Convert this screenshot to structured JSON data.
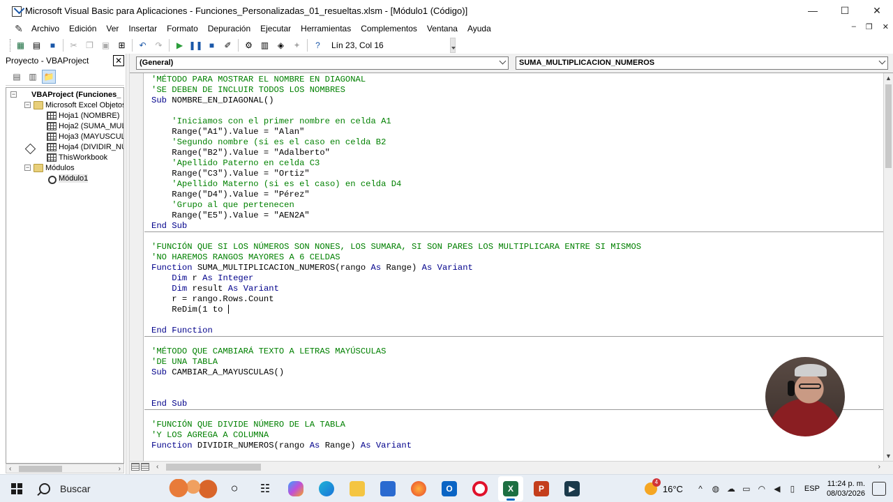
{
  "window": {
    "title": "Microsoft Visual Basic para Aplicaciones - Funciones_Personalizadas_01_resueltas.xlsm - [Módulo1 (Código)]",
    "minimize": "—",
    "maximize": "☐",
    "close": "✕"
  },
  "menu": {
    "items": [
      "Archivo",
      "Edición",
      "Ver",
      "Insertar",
      "Formato",
      "Depuración",
      "Ejecutar",
      "Herramientas",
      "Complementos",
      "Ventana",
      "Ayuda"
    ],
    "mdi_minimize": "–",
    "mdi_restore": "❐",
    "mdi_close": "✕"
  },
  "toolbar": {
    "cursor_position": "Lín 23, Col 16"
  },
  "project": {
    "title": "Proyecto - VBAProject",
    "close": "✕",
    "tree": {
      "root": "VBAProject (Funciones_",
      "excel_objects": "Microsoft Excel Objetos",
      "sheets": [
        "Hoja1 (NOMBRE)",
        "Hoja2 (SUMA_MULT",
        "Hoja3 (MAYUSCULA",
        "Hoja4 (DIVIDIR_NU"
      ],
      "workbook": "ThisWorkbook",
      "modules": "Módulos",
      "module1": "Módulo1"
    }
  },
  "code_window": {
    "object_combo": "(General)",
    "procedure_combo": "SUMA_MULTIPLICACION_NUMEROS",
    "lines": [
      [
        [
          "c",
          "'MÉTODO PARA MOSTRAR EL NOMBRE EN DIAGONAL"
        ]
      ],
      [
        [
          "c",
          "'SE DEBEN DE INCLUIR TODOS LOS NOMBRES"
        ]
      ],
      [
        [
          "k",
          "Sub"
        ],
        [
          "t",
          " NOMBRE_EN_DIAGONAL()"
        ]
      ],
      [],
      [
        [
          "c",
          "    'Iniciamos con el primer nombre en celda A1"
        ]
      ],
      [
        [
          "t",
          "    Range(\"A1\").Value = \"Alan\""
        ]
      ],
      [
        [
          "c",
          "    'Segundo nombre (si es el caso en celda B2"
        ]
      ],
      [
        [
          "t",
          "    Range(\"B2\").Value = \"Adalberto\""
        ]
      ],
      [
        [
          "c",
          "    'Apellido Paterno en celda C3"
        ]
      ],
      [
        [
          "t",
          "    Range(\"C3\").Value = \"Ortiz\""
        ]
      ],
      [
        [
          "c",
          "    'Apellido Materno (si es el caso) en celda D4"
        ]
      ],
      [
        [
          "t",
          "    Range(\"D4\").Value = \"Pérez\""
        ]
      ],
      [
        [
          "c",
          "    'Grupo al que pertenecen"
        ]
      ],
      [
        [
          "t",
          "    Range(\"E5\").Value = \"AEN2A\""
        ]
      ],
      [
        [
          "k",
          "End Sub"
        ]
      ],
      [],
      [
        [
          "c",
          "'FUNCIÓN QUE SI LOS NÚMEROS SON NONES, LOS SUMARA, SI SON PARES LOS MULTIPLICARA ENTRE SI MISMOS"
        ]
      ],
      [
        [
          "c",
          "'NO HAREMOS RANGOS MAYORES A 6 CELDAS"
        ]
      ],
      [
        [
          "k",
          "Function"
        ],
        [
          "t",
          " SUMA_MULTIPLICACION_NUMEROS(rango "
        ],
        [
          "k",
          "As"
        ],
        [
          "t",
          " Range) "
        ],
        [
          "k",
          "As"
        ],
        [
          "t",
          " "
        ],
        [
          "k",
          "Variant"
        ]
      ],
      [
        [
          "t",
          "    "
        ],
        [
          "k",
          "Dim"
        ],
        [
          "t",
          " r "
        ],
        [
          "k",
          "As"
        ],
        [
          "t",
          " "
        ],
        [
          "k",
          "Integer"
        ]
      ],
      [
        [
          "t",
          "    "
        ],
        [
          "k",
          "Dim"
        ],
        [
          "t",
          " result "
        ],
        [
          "k",
          "As"
        ],
        [
          "t",
          " "
        ],
        [
          "k",
          "Variant"
        ]
      ],
      [
        [
          "t",
          "    r = rango.Rows.Count"
        ]
      ],
      [
        [
          "t",
          "    ReDim(1 to "
        ],
        [
          "caret",
          ""
        ]
      ],
      [],
      [
        [
          "k",
          "End Function"
        ]
      ],
      [],
      [
        [
          "c",
          "'MÉTODO QUE CAMBIARÁ TEXTO A LETRAS MAYÚSCULAS"
        ]
      ],
      [
        [
          "c",
          "'DE UNA TABLA"
        ]
      ],
      [
        [
          "k",
          "Sub"
        ],
        [
          "t",
          " CAMBIAR_A_MAYUSCULAS()"
        ]
      ],
      [],
      [],
      [
        [
          "k",
          "End Sub"
        ]
      ],
      [],
      [
        [
          "c",
          "'FUNCIÓN QUE DIVIDE NÚMERO DE LA TABLA"
        ]
      ],
      [
        [
          "c",
          "'Y LOS AGREGA A COLUMNA"
        ]
      ],
      [
        [
          "k",
          "Function"
        ],
        [
          "t",
          " DIVIDIR_NUMEROS(rango "
        ],
        [
          "k",
          "As"
        ],
        [
          "t",
          " Range) "
        ],
        [
          "k",
          "As"
        ],
        [
          "t",
          " "
        ],
        [
          "k",
          "Variant"
        ]
      ]
    ]
  },
  "taskbar": {
    "search_label": "Buscar",
    "weather_temp": "16°C",
    "weather_badge": "4",
    "language": "ESP",
    "time": "11:24 p. m.",
    "date": "08/03/2026"
  }
}
